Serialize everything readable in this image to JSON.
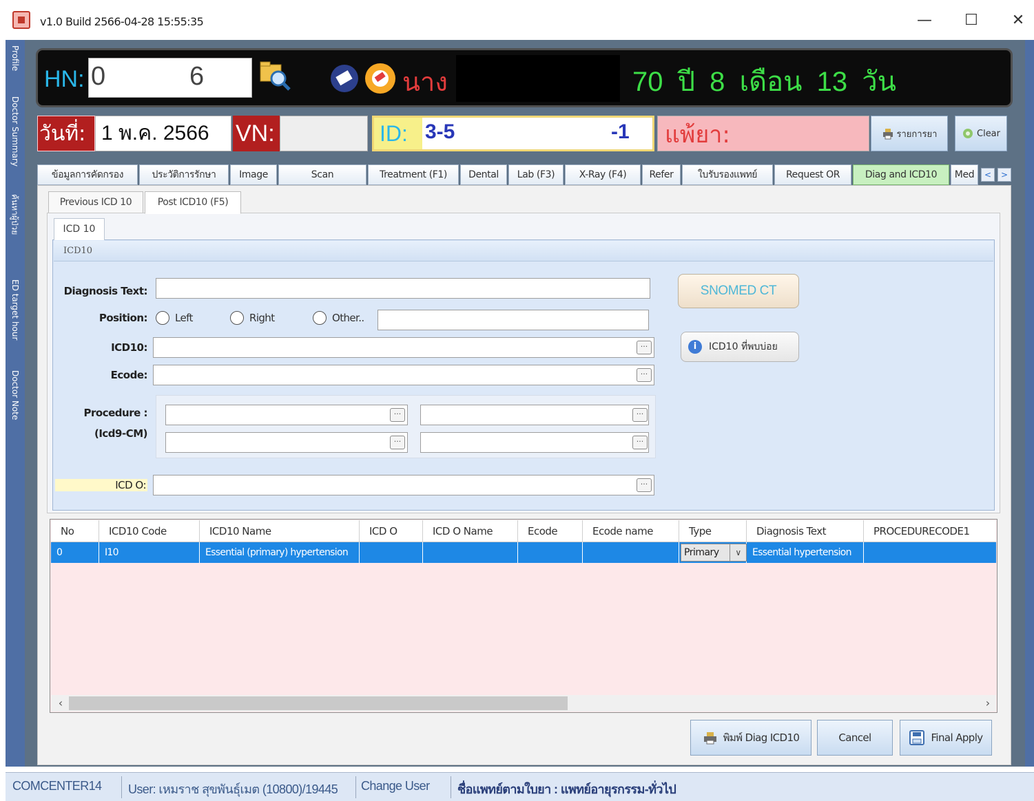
{
  "window": {
    "title": "v1.0 Build 2566-04-28 15:55:35",
    "minimize": "—",
    "maximize": "☐",
    "close": "✕"
  },
  "side_tabs": [
    "Profile",
    "Doctor Summary",
    "ค้นหาผู้ป่วย",
    "ED target hour",
    "Doctor Note"
  ],
  "header": {
    "hn_label": "HN:",
    "hn_value_1": "0",
    "hn_value_2": "6",
    "prefix": "นาง",
    "age": "70 ปี 8 เดือน 13 วัน",
    "date_label": "วันที่:",
    "date_value": "1 พ.ค. 2566",
    "vn_label": "VN:",
    "vn_value": "",
    "id_label": "ID:",
    "id_value_1": "3-5",
    "id_value_2": "-1",
    "allergy_label": "แพ้ยา:",
    "drug_button": "รายการยา",
    "clear_button": "Clear"
  },
  "tabs": [
    {
      "label": "ข้อมูลการคัดกรอง"
    },
    {
      "label": "ประวัติการรักษา"
    },
    {
      "label": "Image"
    },
    {
      "label": "Scan"
    },
    {
      "label": "Treatment (F1)"
    },
    {
      "label": "Dental"
    },
    {
      "label": "Lab (F3)"
    },
    {
      "label": "X-Ray (F4)"
    },
    {
      "label": "Refer"
    },
    {
      "label": "ใบรับรองแพทย์"
    },
    {
      "label": "Request OR"
    },
    {
      "label": "Diag and ICD10"
    },
    {
      "label": "Med"
    }
  ],
  "sub_tabs": [
    "Previous ICD 10",
    "Post ICD10 (F5)"
  ],
  "inner_tab": "ICD 10",
  "group_title": "ICD10",
  "form": {
    "diagnosis_label": "Diagnosis Text:",
    "diagnosis_value": "",
    "position_label": "Position:",
    "position_options": [
      "Left",
      "Right",
      "Other.."
    ],
    "position_other_value": "",
    "icd10_label": "ICD10:",
    "icd10_value": "",
    "ecode_label": "Ecode:",
    "ecode_value": "",
    "procedure_label_1": "Procedure :",
    "procedure_label_2": "(Icd9-CM)",
    "icdo_label": "ICD O:",
    "icdo_value": "",
    "ellipsis": "···",
    "snomed_button": "SNOMED CT",
    "icd10_more_button": "ICD10 ที่พบบ่อย"
  },
  "grid": {
    "columns": [
      "No",
      "ICD10  Code",
      "ICD10  Name",
      "ICD O",
      "ICD O Name",
      "Ecode",
      "Ecode name",
      "Type",
      "Diagnosis Text",
      "PROCEDURECODE1"
    ],
    "rows": [
      {
        "no": "0",
        "code": "I10",
        "name": "Essential (primary) hypertension",
        "icdo": "",
        "icdo_name": "",
        "ecode": "",
        "ecode_name": "",
        "type": "Primary",
        "diag_text": "Essential hypertension",
        "proc1": ""
      }
    ]
  },
  "footer_buttons": {
    "print": "พิมพ์ Diag ICD10",
    "cancel": "Cancel",
    "final": "Final Apply"
  },
  "status": {
    "computer": "COMCENTER14",
    "user": "User: เหมราช สุขพันธุ์เมต (10800)/19445",
    "change_user": "Change User",
    "doctor": "ชื่อแพทย์ตามใบยา : แพทย์อายุรกรรม-ทั่วไป"
  },
  "colors": {
    "accent_blue": "#1e88e5",
    "date_red": "#b21f1f",
    "age_green": "#3dde47",
    "active_tab": "#c8f0c0",
    "allergy_pink": "#f7b8bd"
  }
}
